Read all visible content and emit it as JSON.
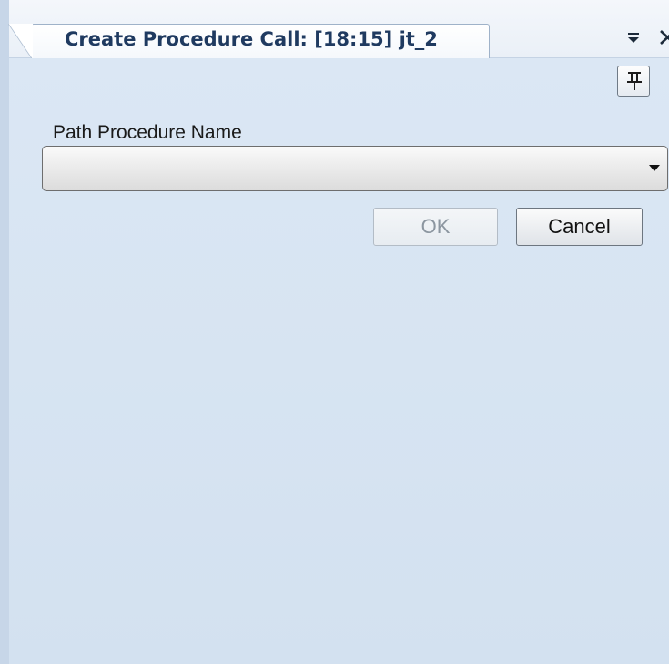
{
  "tab": {
    "title": "Create Procedure Call: [18:15] jt_2"
  },
  "form": {
    "path_procedure_label": "Path Procedure Name",
    "path_procedure_value": ""
  },
  "buttons": {
    "ok": "OK",
    "cancel": "Cancel"
  },
  "icons": {
    "menu": "dropdown-menu-icon",
    "close": "close-icon",
    "pin": "pin-icon",
    "arrow": "chevron-down-icon"
  }
}
